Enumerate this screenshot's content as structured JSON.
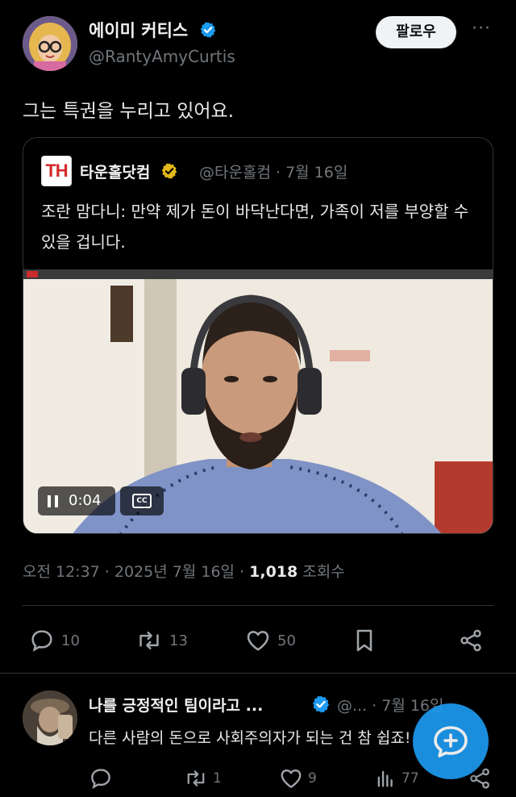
{
  "author": {
    "display_name": "에이미 커티스",
    "handle": "@RantyAmyCurtis",
    "follow_label": "팔로우",
    "more_label": "···"
  },
  "tweet": {
    "text": "그는 특권을 누리고 있어요.",
    "timestamp": "오전 12:37 · 2025년 7월 16일 · ",
    "views_count": "1,018",
    "views_label": " 조회수"
  },
  "quote": {
    "logo_text": "TH",
    "display_name": "타운홀닷컴",
    "handle_date": "@타운홀컴 · 7월 16일",
    "text": "조란 맘다니: 만약 제가 돈이 바닥난다면, 가족이 저를 부양할 수 있을 겁니다.",
    "video_time": "0:04",
    "cc_label": "CC"
  },
  "actions": {
    "replies": "10",
    "reposts": "13",
    "likes": "50"
  },
  "reply": {
    "display_name": "나를 긍정적인 팀이라고 ...",
    "handle_date": "@... · 7월 16일",
    "text": "다른 사람의 돈으로 사회주의자가 되는 건 참 쉽죠!",
    "replies": "",
    "reposts": "1",
    "likes": "9",
    "views": "77"
  },
  "colors": {
    "background": "#000000",
    "accent": "#1d9bf0",
    "muted": "#71767b",
    "verified_gold": "#e2b719"
  }
}
